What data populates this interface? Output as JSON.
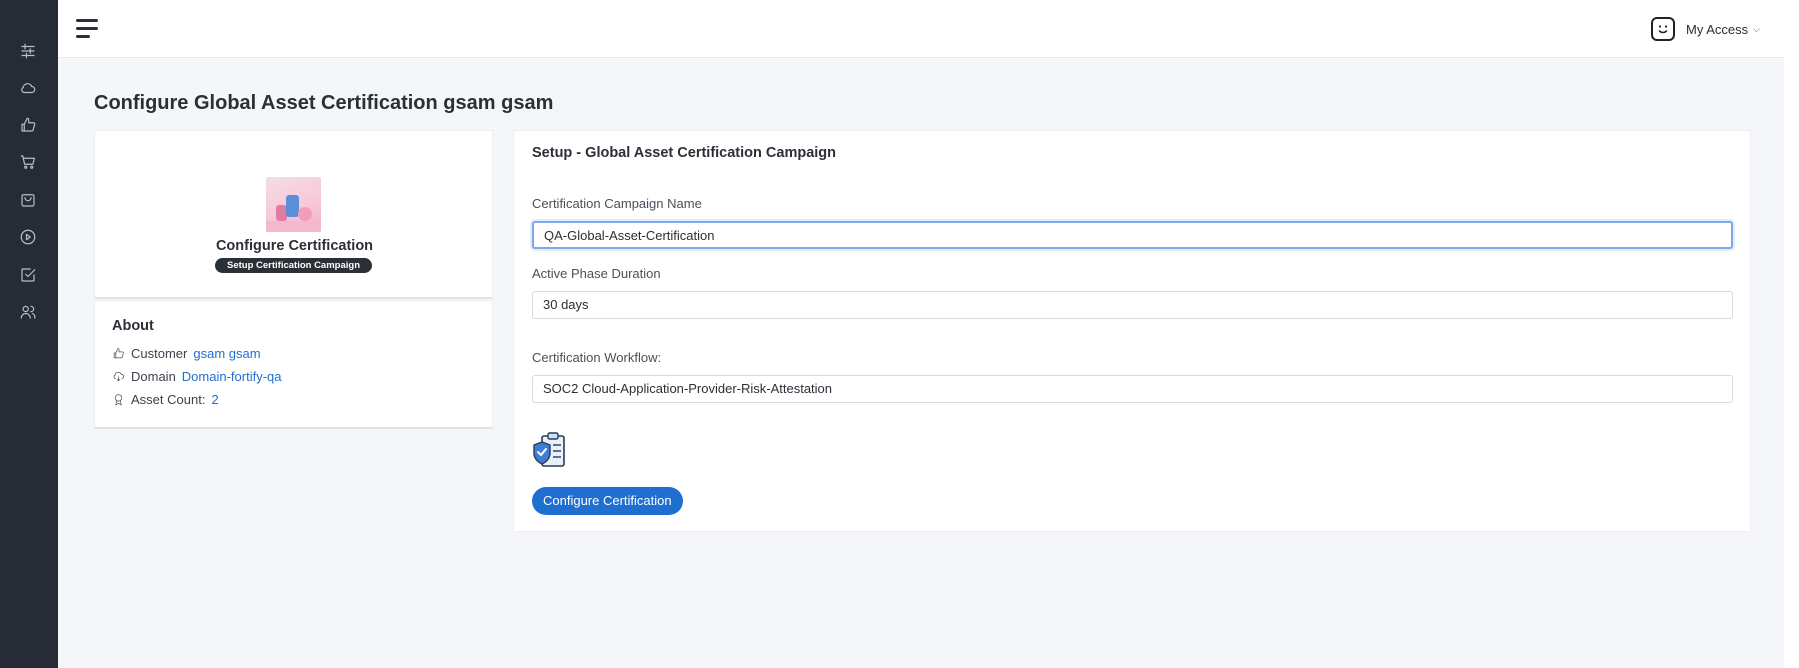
{
  "header": {
    "access_menu_label": "My Access"
  },
  "sidebar": {
    "items": [
      {
        "icon": "sliders-icon"
      },
      {
        "icon": "cloud-icon"
      },
      {
        "icon": "thumbs-up-icon"
      },
      {
        "icon": "cart-icon"
      },
      {
        "icon": "bag-icon"
      },
      {
        "icon": "play-icon"
      },
      {
        "icon": "checkbox-icon"
      },
      {
        "icon": "users-icon"
      }
    ]
  },
  "page": {
    "title": "Configure Global Asset Certification gsam gsam"
  },
  "profile": {
    "name": "Configure Certification",
    "badge": "Setup Certification Campaign"
  },
  "about": {
    "title": "About",
    "customer_label": "Customer",
    "customer_value": "gsam gsam",
    "domain_label": "Domain",
    "domain_value": "Domain-fortify-qa",
    "asset_count_label": "Asset Count:",
    "asset_count_value": "2"
  },
  "form": {
    "title": "Setup - Global Asset Certification Campaign",
    "campaign_name_label": "Certification Campaign Name",
    "campaign_name_value": "QA-Global-Asset-Certification",
    "duration_label": "Active Phase Duration",
    "duration_value": "30 days",
    "workflow_label": "Certification Workflow:",
    "workflow_value": "SOC2 Cloud-Application-Provider-Risk-Attestation",
    "submit_label": "Configure Certification"
  },
  "colors": {
    "sidebar_bg": "#262b35",
    "accent": "#1f6fd1",
    "page_bg": "#f4f6f9"
  }
}
